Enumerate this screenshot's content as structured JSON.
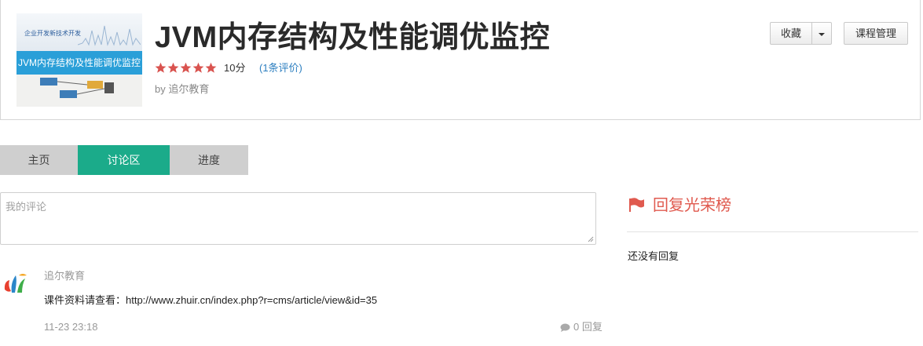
{
  "course": {
    "title": "JVM内存结构及性能调优监控",
    "rating_stars": 5,
    "score": "10分",
    "reviews": "(1条评价)",
    "by": "by 追尔教育",
    "thumbnail": {
      "small_title": "企业开发新技术开发",
      "band_text": "JVM内存结构及性能调优监控"
    }
  },
  "actions": {
    "favorite": "收藏",
    "manage": "课程管理"
  },
  "tabs": [
    {
      "label": "主页",
      "active": false
    },
    {
      "label": "讨论区",
      "active": true
    },
    {
      "label": "进度",
      "active": false
    }
  ],
  "comment_input": {
    "placeholder": "我的评论"
  },
  "comments": [
    {
      "author": "追尔教育",
      "text": "课件资料请查看：http://www.zhuir.cn/index.php?r=cms/article/view&id=35",
      "time": "11-23 23:18",
      "replies": "0 回复"
    }
  ],
  "ranking": {
    "title": "回复光荣榜",
    "empty": "还没有回复"
  },
  "colors": {
    "accent_tab": "#1bab8a",
    "star": "#d9534f",
    "link": "#2d7fc0",
    "ranking": "#e05a4f"
  },
  "icons": [
    "star-icon",
    "caret-down-icon",
    "flag-icon",
    "comment-bubble-icon",
    "resize-grip-icon",
    "logo-avatar"
  ]
}
